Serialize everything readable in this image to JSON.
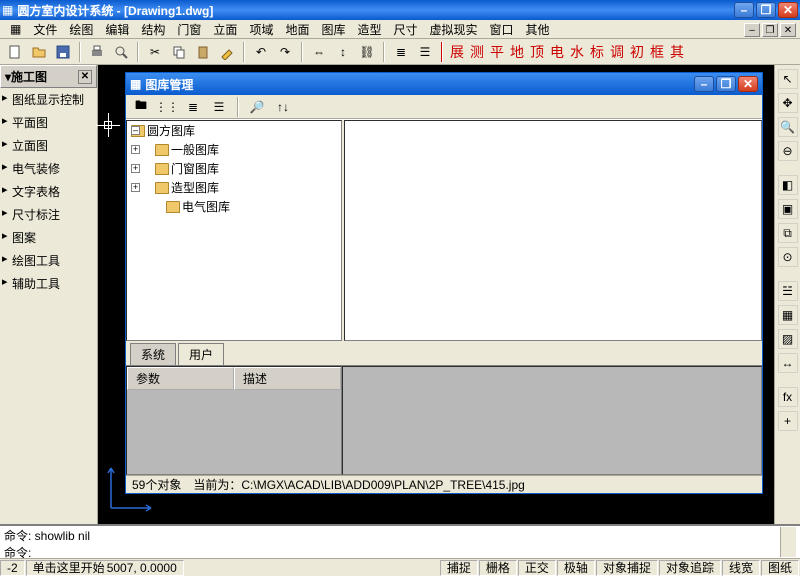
{
  "app_title": "圆方室内设计系统 - [Drawing1.dwg]",
  "menubar": [
    "文件",
    "绘图",
    "编辑",
    "结构",
    "门窗",
    "立面",
    "项域",
    "地面",
    "图库",
    "造型",
    "尺寸",
    "虚拟现实",
    "窗口",
    "其他"
  ],
  "red_chars": [
    "展",
    "测",
    "平",
    "地",
    "顶",
    "电",
    "水",
    "标",
    "调",
    "初",
    "框",
    "其"
  ],
  "left_panel": {
    "title": "施工图",
    "items": [
      "图纸显示控制",
      "平面图",
      "立面图",
      "电气装修",
      "文字表格",
      "尺寸标注",
      "图案",
      "绘图工具",
      "辅助工具"
    ]
  },
  "right_tool_icons": [
    "arrow-icon",
    "pan-icon",
    "zoom-in-icon",
    "zoom-out-icon",
    "sep",
    "zoom-window-icon",
    "zoom-extents-icon",
    "zoom-scale-icon",
    "zoom-center-icon",
    "sep",
    "layer-icon",
    "color-icon",
    "hatch-icon",
    "measure-icon",
    "sep",
    "fx-icon",
    "plus-icon"
  ],
  "dialog": {
    "title": "图库管理",
    "tree_root": "圆方图库",
    "tree_children": [
      "一般图库",
      "门窗图库",
      "造型图库",
      "电气图库"
    ],
    "tabs": [
      "系统",
      "用户"
    ],
    "param_headers": [
      "参数",
      "描述"
    ],
    "status_count": "59个对象",
    "status_path": "当前为：C:\\MGX\\ACAD\\LIB\\ADD009\\PLAN\\2P_TREE\\415.jpg"
  },
  "command": {
    "line1": "命令: showlib nil",
    "line2": "命令:",
    "line3": "命令:"
  },
  "status": {
    "coord_prefix": "-2",
    "hint": "单击这里开始",
    "coords": "5007, 0.0000",
    "toggles": [
      "捕捉",
      "栅格",
      "正交",
      "极轴",
      "对象捕捉",
      "对象追踪",
      "线宽",
      "图纸"
    ]
  }
}
